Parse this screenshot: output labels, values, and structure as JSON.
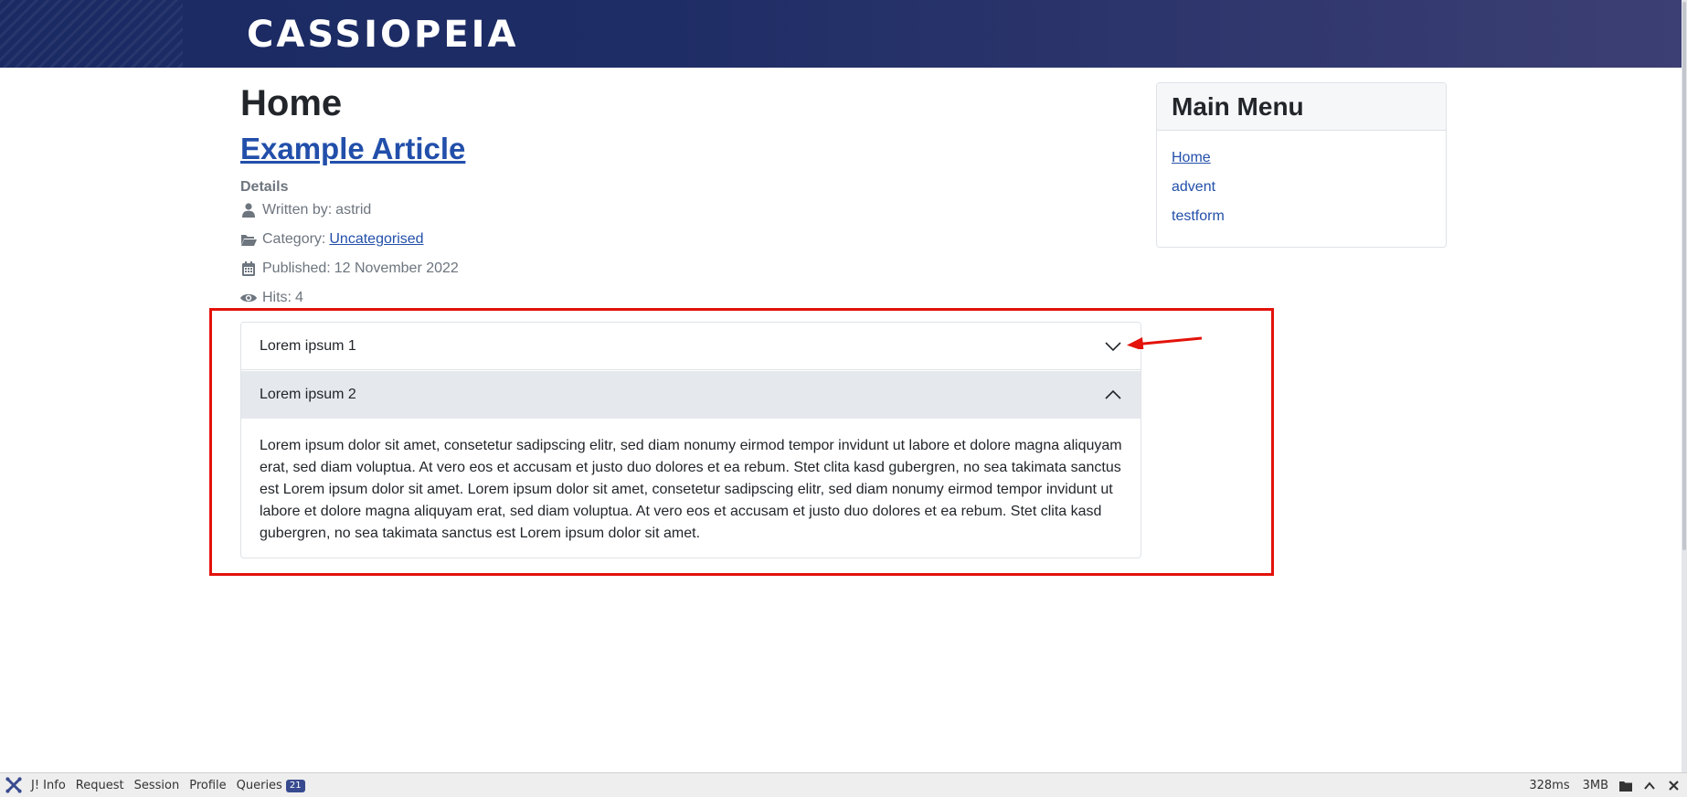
{
  "header": {
    "brand": "CASSIOPEIA"
  },
  "page": {
    "title": "Home"
  },
  "article": {
    "title": "Example Article",
    "details_label": "Details",
    "written_by_label": "Written by:",
    "author": "astrid",
    "category_label": "Category:",
    "category": "Uncategorised",
    "published_label": "Published:",
    "published_date": "12 November 2022",
    "hits_label": "Hits:",
    "hits": "4"
  },
  "accordion": {
    "items": [
      {
        "label": "Lorem ipsum 1",
        "expanded": false
      },
      {
        "label": "Lorem ipsum 2",
        "expanded": true,
        "body": "Lorem ipsum dolor sit amet, consetetur sadipscing elitr, sed diam nonumy eirmod tempor invidunt ut labore et dolore magna aliquyam erat, sed diam voluptua. At vero eos et accusam et justo duo dolores et ea rebum. Stet clita kasd gubergren, no sea takimata sanctus est Lorem ipsum dolor sit amet. Lorem ipsum dolor sit amet, consetetur sadipscing elitr, sed diam nonumy eirmod tempor invidunt ut labore et dolore magna aliquyam erat, sed diam voluptua. At vero eos et accusam et justo duo dolores et ea rebum. Stet clita kasd gubergren, no sea takimata sanctus est Lorem ipsum dolor sit amet."
      }
    ]
  },
  "sidebar": {
    "title": "Main Menu",
    "items": [
      {
        "label": "Home",
        "active": true
      },
      {
        "label": "advent",
        "active": false
      },
      {
        "label": "testform",
        "active": false
      }
    ]
  },
  "debugbar": {
    "tabs": [
      "J! Info",
      "Request",
      "Session",
      "Profile",
      "Queries"
    ],
    "queries_count": "21",
    "time": "328ms",
    "memory": "3MB"
  },
  "colors": {
    "annotation": "#e3120b",
    "link": "#224faa",
    "header_bg": "#1f2d66"
  },
  "icons": [
    "user-icon",
    "folder-open-icon",
    "calendar-icon",
    "eye-icon",
    "chevron-down-icon",
    "chevron-up-icon",
    "joomla-icon",
    "folder-icon",
    "caret-up-icon",
    "close-icon"
  ]
}
